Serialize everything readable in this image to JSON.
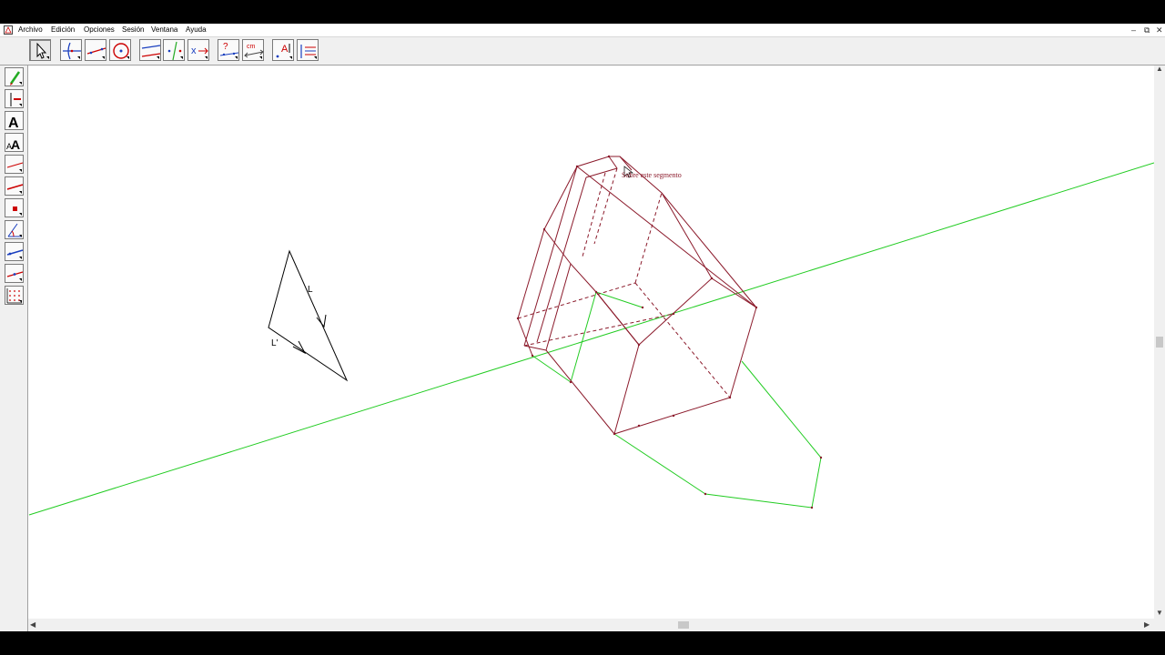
{
  "window": {
    "menus": [
      "Archivo",
      "Edición",
      "Opciones",
      "Sesión",
      "Ventana",
      "Ayuda"
    ],
    "controls": [
      "–",
      "⧉",
      "✕"
    ]
  },
  "toolbar": {
    "tools": [
      "pointer-tool",
      "curves-tool",
      "lines-tool",
      "circles-tool",
      "constructions-tool",
      "transformations-tool",
      "macros-tool",
      "properties-tool",
      "measure-tool",
      "display-tool",
      "draw-tool"
    ],
    "measure_icon_text": "cm",
    "properties_icon_text": "?",
    "display_icon_text": "A"
  },
  "sidebar": {
    "tools": [
      "pencil",
      "segment-label",
      "text",
      "label-text",
      "line-red",
      "line-red-2",
      "point",
      "angle",
      "segment-blue",
      "segment-red",
      "grid"
    ],
    "text_icon": "A",
    "label_text_icon": "A"
  },
  "canvas": {
    "tooltip": "Sobre este segmento",
    "label_L": "L",
    "label_Lprime": "L'",
    "colors": {
      "dark_red": "#8b1a2b",
      "green": "#22cc22",
      "black": "#000000"
    }
  }
}
